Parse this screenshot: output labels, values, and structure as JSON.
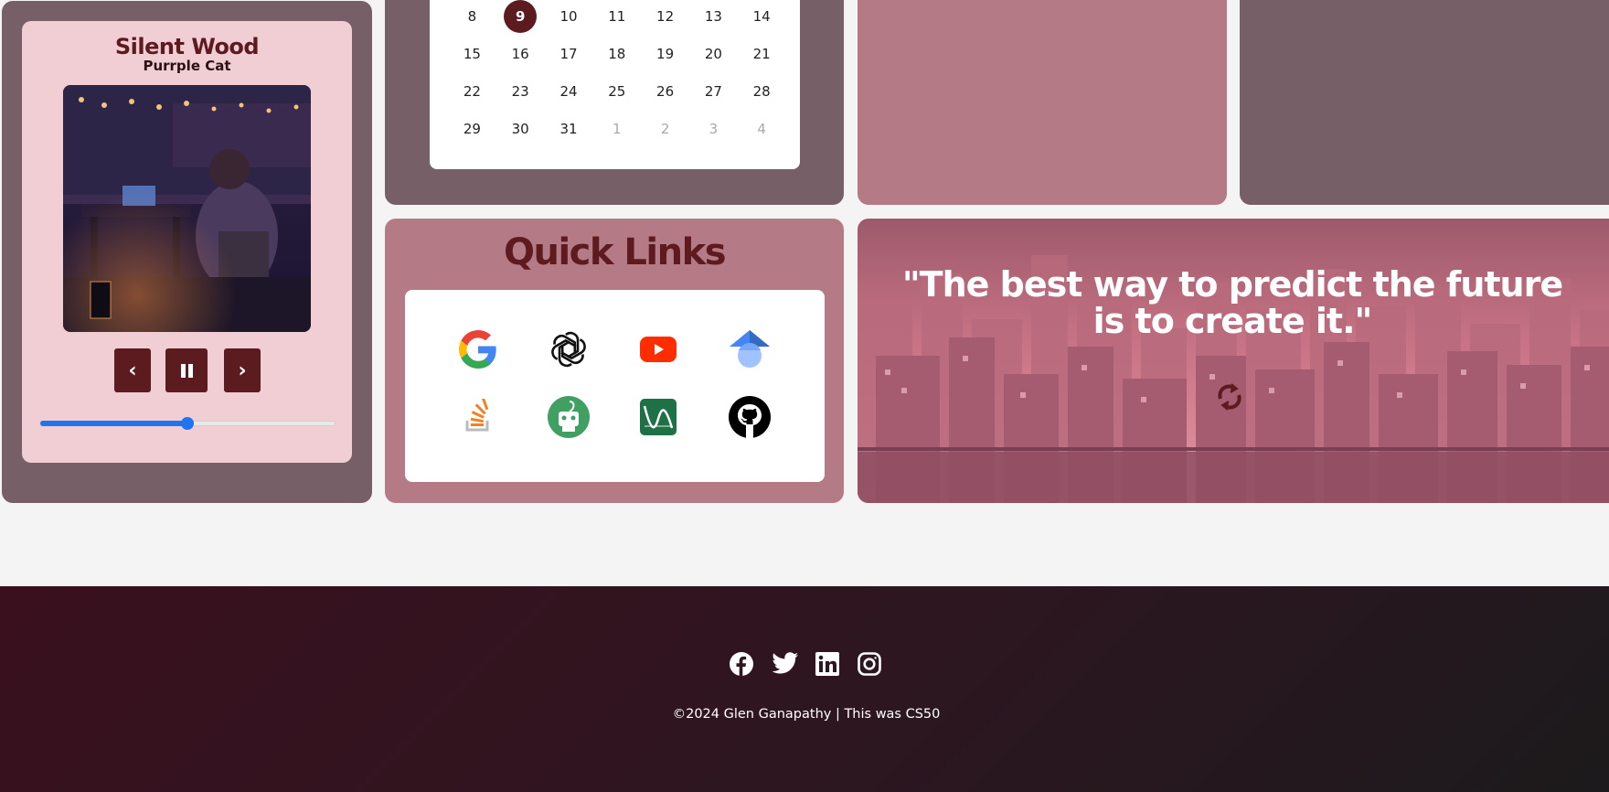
{
  "player": {
    "song_title": "Silent Wood",
    "artist": "Purrple Cat",
    "prev_label": "‹",
    "pause_label": "❚❚",
    "next_label": "›",
    "progress": 0.5
  },
  "calendar": {
    "rows": [
      [
        {
          "d": "8"
        },
        {
          "d": "9",
          "today": true
        },
        {
          "d": "10"
        },
        {
          "d": "11"
        },
        {
          "d": "12"
        },
        {
          "d": "13"
        },
        {
          "d": "14"
        }
      ],
      [
        {
          "d": "15"
        },
        {
          "d": "16"
        },
        {
          "d": "17"
        },
        {
          "d": "18"
        },
        {
          "d": "19"
        },
        {
          "d": "20"
        },
        {
          "d": "21"
        }
      ],
      [
        {
          "d": "22"
        },
        {
          "d": "23"
        },
        {
          "d": "24"
        },
        {
          "d": "25"
        },
        {
          "d": "26"
        },
        {
          "d": "27"
        },
        {
          "d": "28"
        }
      ],
      [
        {
          "d": "29"
        },
        {
          "d": "30"
        },
        {
          "d": "31"
        },
        {
          "d": "1",
          "other": true
        },
        {
          "d": "2",
          "other": true
        },
        {
          "d": "3",
          "other": true
        },
        {
          "d": "4",
          "other": true
        }
      ]
    ]
  },
  "quick_links": {
    "title": "Quick Links",
    "icons": [
      "google-icon",
      "openai-icon",
      "youtube-icon",
      "google-scholar-icon",
      "stackoverflow-icon",
      "overleaf-bot-icon",
      "desmos-icon",
      "github-icon"
    ]
  },
  "quote": {
    "text": "\"The best way to predict the future is to create it.\""
  },
  "footer": {
    "social_icons": [
      "facebook-icon",
      "twitter-icon",
      "linkedin-icon",
      "instagram-icon"
    ],
    "copyright": "©2024 Glen Ganapathy | This was CS50"
  },
  "colors": {
    "accent": "#5c1c1f",
    "tile_dark": "#775f67",
    "tile_pink": "#b47a86",
    "player_card": "#f1cdd4",
    "slider": "#1f74ef"
  }
}
